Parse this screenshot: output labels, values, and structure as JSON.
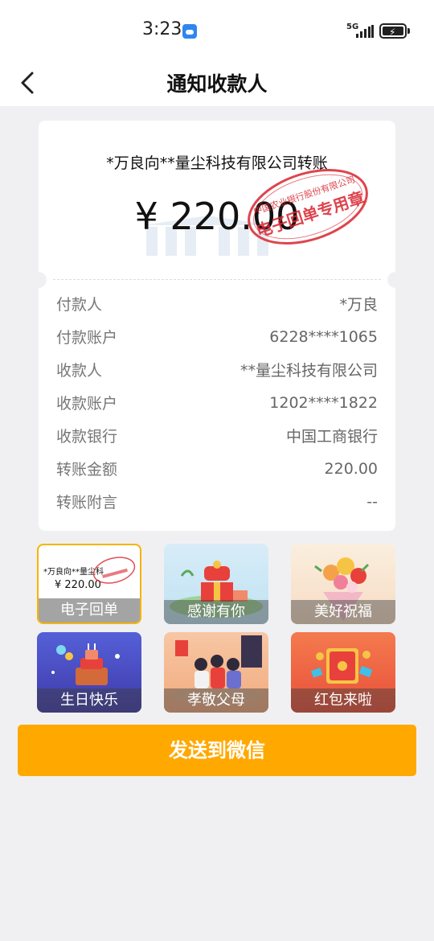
{
  "status_bar": {
    "time": "3:23",
    "network_label": "5G",
    "weather_icon": "weather-app-icon",
    "signal_icon": "signal-icon",
    "battery_icon": "battery-charging-icon"
  },
  "nav": {
    "title": "通知收款人",
    "back_icon": "back-arrow-icon"
  },
  "receipt": {
    "title": "*万良向**量尘科技有限公司转账",
    "amount": "¥ 220.00",
    "stamp": {
      "outer_text": "中国农业银行股份有限公司",
      "inner_text": "电子回单专用章",
      "color": "#d8242e"
    },
    "rows": [
      {
        "label": "付款人",
        "value": "*万良"
      },
      {
        "label": "付款账户",
        "value": "6228****1065"
      },
      {
        "label": "收款人",
        "value": "**量尘科技有限公司"
      },
      {
        "label": "收款账户",
        "value": "1202****1822"
      },
      {
        "label": "收款银行",
        "value": "中国工商银行"
      },
      {
        "label": "转账金额",
        "value": "220.00"
      },
      {
        "label": "转账附言",
        "value": "--"
      }
    ]
  },
  "templates": [
    {
      "label": "电子回单",
      "selected": true,
      "mini_title": "*万良向**量尘科",
      "mini_amount": "¥ 220.00"
    },
    {
      "label": "感谢有你",
      "selected": false
    },
    {
      "label": "美好祝福",
      "selected": false
    },
    {
      "label": "生日快乐",
      "selected": false
    },
    {
      "label": "孝敬父母",
      "selected": false
    },
    {
      "label": "红包来啦",
      "selected": false
    }
  ],
  "send_button": {
    "label": "发送到微信",
    "color": "#ffa800"
  }
}
